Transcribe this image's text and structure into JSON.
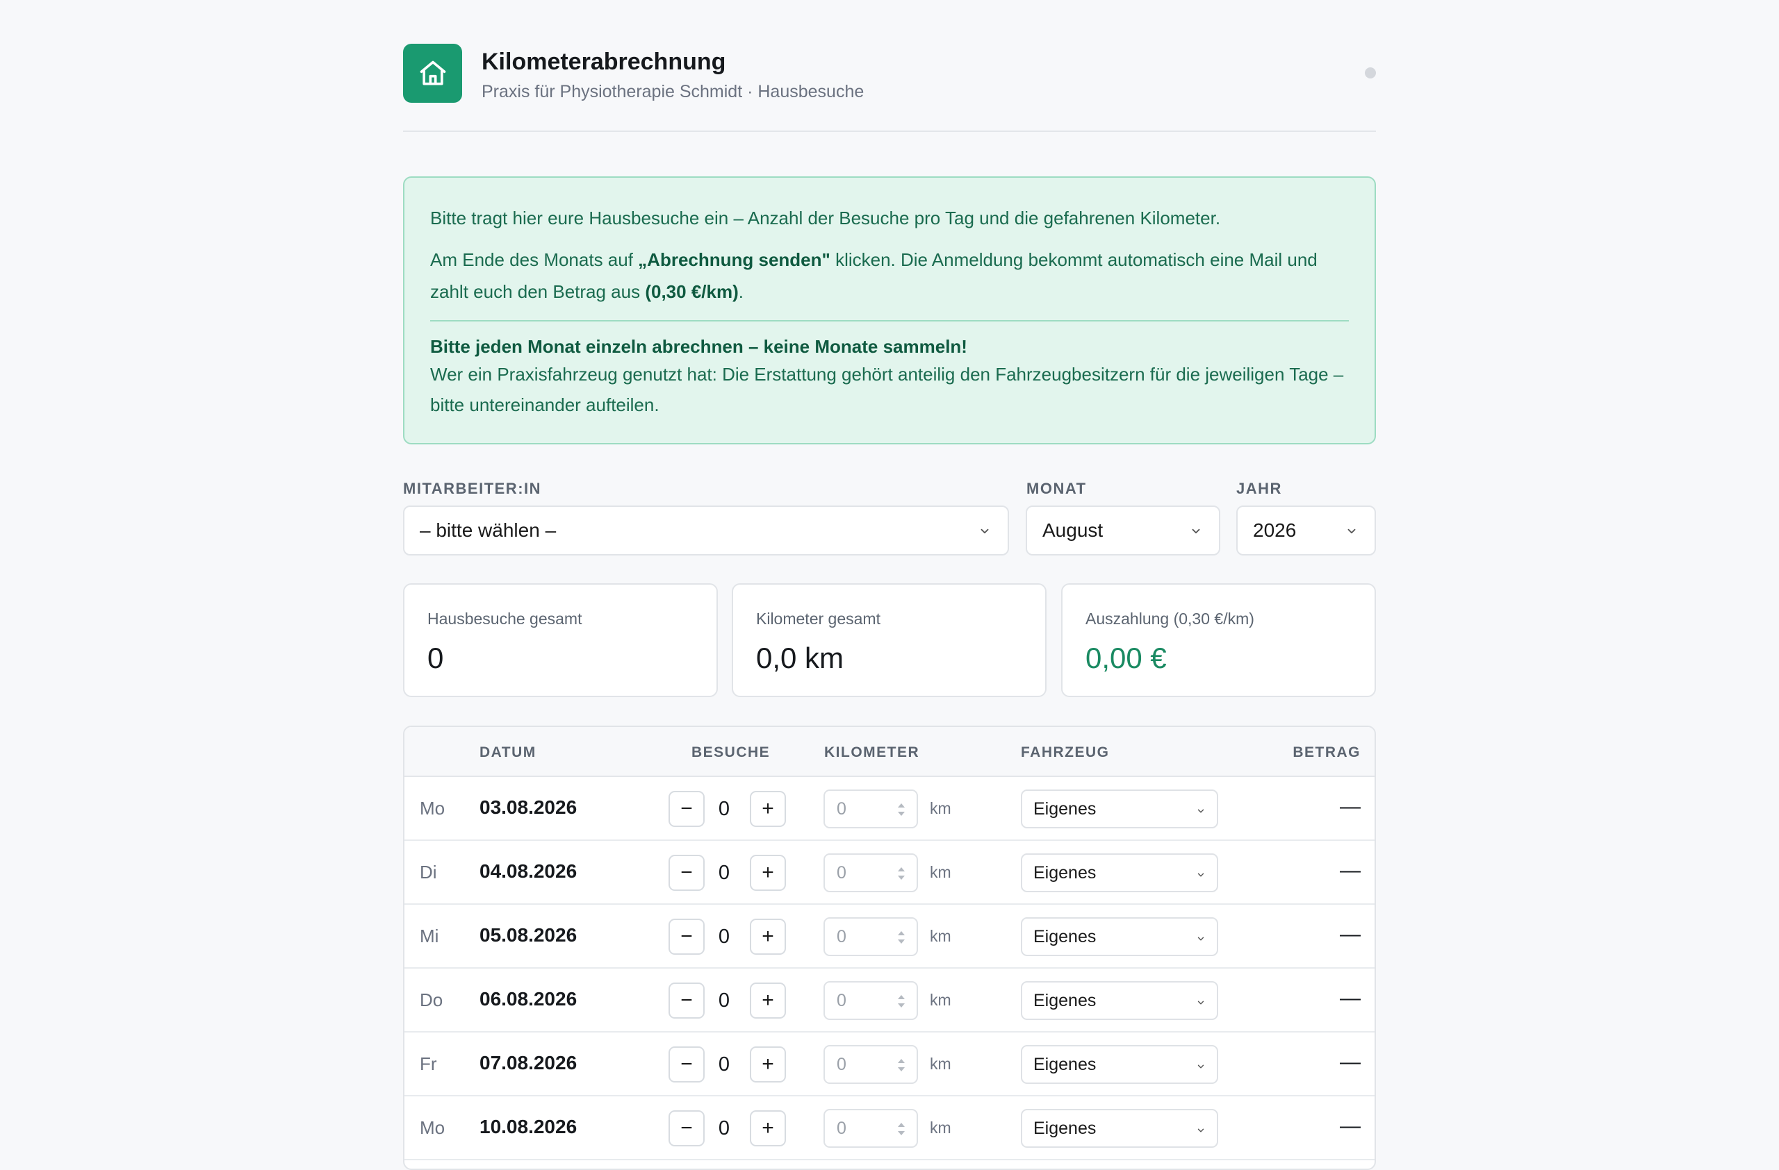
{
  "header": {
    "title": "Kilometerabrechnung",
    "subtitle": "Praxis für Physiotherapie Schmidt · Hausbesuche",
    "logo_icon": "house-icon",
    "brand_color": "#1a9a70"
  },
  "info": {
    "line1": "Bitte tragt hier eure Hausbesuche ein – Anzahl der Besuche pro Tag und die gefahrenen Kilometer.",
    "line2_a": "Am Ende des Monats auf ",
    "line2_b": "„Abrechnung senden\"",
    "line2_c": " klicken. Die Anmeldung bekommt automatisch eine Mail und zahlt euch den Betrag aus ",
    "line2_d": "(0,30 €/km)",
    "line2_e": ".",
    "warning": "Bitte jeden Monat einzeln abrechnen – keine Monate sammeln!",
    "line3": "Wer ein Praxisfahrzeug genutzt hat: Die Erstattung gehört anteilig den Fahrzeugbesitzern für die jeweiligen Tage – bitte untereinander aufteilen."
  },
  "form": {
    "employee_label": "MITARBEITER:IN",
    "employee_value": "– bitte wählen –",
    "month_label": "MONAT",
    "month_value": "August",
    "year_label": "JAHR",
    "year_value": "2026"
  },
  "stats": {
    "visits_label": "Hausbesuche gesamt",
    "visits_value": "0",
    "km_label": "Kilometer gesamt",
    "km_value": "0,0 km",
    "payout_label": "Auszahlung (0,30 €/km)",
    "payout_value": "0,00 €"
  },
  "table": {
    "headers": {
      "date": "DATUM",
      "visits": "BESUCHE",
      "km": "KILOMETER",
      "vehicle": "FAHRZEUG",
      "amount": "BETRAG"
    },
    "rows": [
      {
        "weekday": "Mo",
        "date": "03.08.2026",
        "minus": "−",
        "visits": "0",
        "plus": "+",
        "km_placeholder": "0",
        "unit": "km",
        "vehicle": "Eigenes",
        "amount": "—"
      },
      {
        "weekday": "Di",
        "date": "04.08.2026",
        "minus": "−",
        "visits": "0",
        "plus": "+",
        "km_placeholder": "0",
        "unit": "km",
        "vehicle": "Eigenes",
        "amount": "—"
      },
      {
        "weekday": "Mi",
        "date": "05.08.2026",
        "minus": "−",
        "visits": "0",
        "plus": "+",
        "km_placeholder": "0",
        "unit": "km",
        "vehicle": "Eigenes",
        "amount": "—"
      },
      {
        "weekday": "Do",
        "date": "06.08.2026",
        "minus": "−",
        "visits": "0",
        "plus": "+",
        "km_placeholder": "0",
        "unit": "km",
        "vehicle": "Eigenes",
        "amount": "—"
      },
      {
        "weekday": "Fr",
        "date": "07.08.2026",
        "minus": "−",
        "visits": "0",
        "plus": "+",
        "km_placeholder": "0",
        "unit": "km",
        "vehicle": "Eigenes",
        "amount": "—"
      },
      {
        "weekday": "Mo",
        "date": "10.08.2026",
        "minus": "−",
        "visits": "0",
        "plus": "+",
        "km_placeholder": "0",
        "unit": "km",
        "vehicle": "Eigenes",
        "amount": "—"
      }
    ]
  }
}
